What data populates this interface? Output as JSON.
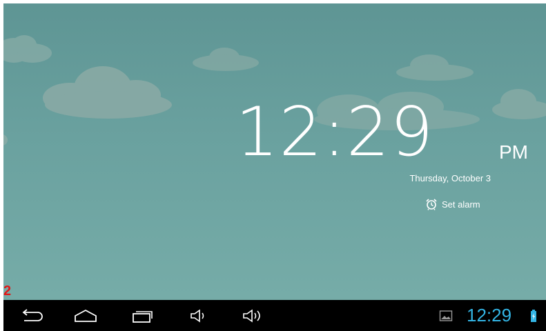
{
  "lockscreen": {
    "clock_time": "12:29",
    "clock_ampm": "PM",
    "date": "Thursday, October 3",
    "alarm_label": "Set alarm"
  },
  "overlay": {
    "badge": "2"
  },
  "status_bar": {
    "time": "12:29",
    "accent_color": "#33b5e5"
  },
  "nav_buttons": [
    {
      "name": "back",
      "icon": "back-icon"
    },
    {
      "name": "home",
      "icon": "home-icon"
    },
    {
      "name": "recents",
      "icon": "recent-apps-icon"
    },
    {
      "name": "volume-down",
      "icon": "volume-down-icon"
    },
    {
      "name": "volume-up",
      "icon": "volume-up-icon"
    }
  ],
  "colors": {
    "wallpaper": "#6aa19f",
    "navbar": "#000000",
    "badge": "#e01818"
  }
}
